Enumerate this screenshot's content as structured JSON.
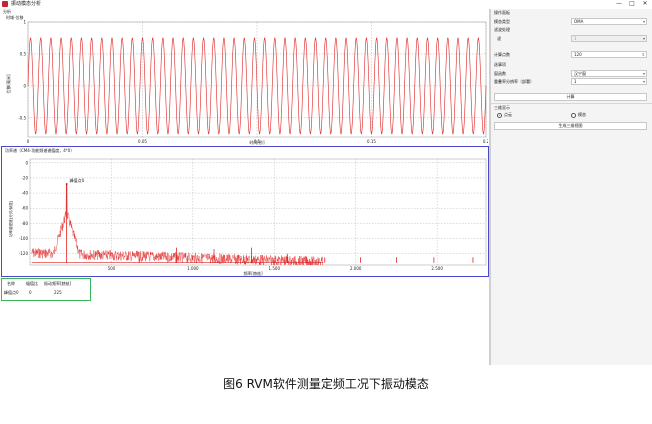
{
  "window": {
    "title": "振动模态分析",
    "min_label": "—",
    "max_label": "□",
    "close_label": "✕"
  },
  "time_chart": {
    "panel_label": "分析",
    "title": "时域-位移",
    "xlabel": "时间[秒]",
    "ylabel": "位移[毫米]",
    "x_ticks": [
      "0",
      "0.05",
      "0.1",
      "0.15",
      "0.2"
    ],
    "y_ticks": [
      "1",
      "0.5",
      "0",
      "-0.5"
    ]
  },
  "spectrum_chart": {
    "panel_label": "功率谱（CM4-功能频谱谱值度，4*0）",
    "xlabel": "频率[赫兹]",
    "ylabel": "功率谱密度[分贝/赫兹]",
    "x_ticks": [
      "500",
      "1.000",
      "1.500",
      "2.000",
      "2.500"
    ],
    "y_ticks": [
      "0",
      "-20",
      "-40",
      "-60",
      "-80",
      "-100",
      "-120"
    ],
    "peak_label": "峰值点0"
  },
  "chart_data": [
    {
      "type": "line",
      "title": "时域-位移",
      "xlabel": "时间[秒]",
      "ylabel": "位移[毫米]",
      "xlim": [
        0,
        0.2
      ],
      "ylim": [
        -0.8,
        1.0
      ],
      "series": [
        {
          "frequency_hz": 225,
          "amplitude": 0.75,
          "offset": 0.0
        }
      ]
    },
    {
      "type": "line",
      "xlabel": "频率[赫兹]",
      "ylabel": "功率谱密度[分贝/赫兹]",
      "xlim": [
        0,
        2800
      ],
      "ylim": [
        -135,
        5
      ],
      "peak": {
        "x": 225,
        "y": -28,
        "label": "峰值点0"
      },
      "harmonic_spikes": [
        {
          "x": 670,
          "y": -118
        },
        {
          "x": 900,
          "y": -112
        },
        {
          "x": 1130,
          "y": -114
        },
        {
          "x": 1360,
          "y": -112
        },
        {
          "x": 1580,
          "y": -120
        },
        {
          "x": 1810,
          "y": -125
        },
        {
          "x": 2030,
          "y": -125
        },
        {
          "x": 2250,
          "y": -125
        },
        {
          "x": 2480,
          "y": -125
        },
        {
          "x": 2720,
          "y": -125
        }
      ]
    }
  ],
  "settings": {
    "panel_title": "操作面板",
    "mode_type_label": "模态类型",
    "mode_type_value": "OMA",
    "pre_process_label": "滤波处理",
    "pre_process_sub_label": "滤",
    "pre_process_value": "1",
    "calc_points_label": "计算点数",
    "calc_points_value": "120",
    "filter_group_label": "选事项",
    "window_label": "窗函数",
    "window_value": "汉宁窗",
    "overlap_label": "重叠率分辨率（部署）",
    "overlap_value": "1",
    "calc_button": "计算",
    "display_group_label": "三维显示",
    "radio_a": "点云",
    "radio_b": "模态",
    "generate_button": "生成三维视图"
  },
  "result_table": {
    "headers": [
      "名称",
      "幅值比",
      "振动频率[赫兹]"
    ],
    "rows": [
      [
        "峰值点0",
        "0",
        "225"
      ]
    ]
  },
  "caption": "图6 RVM软件测量定频工况下振动模态"
}
